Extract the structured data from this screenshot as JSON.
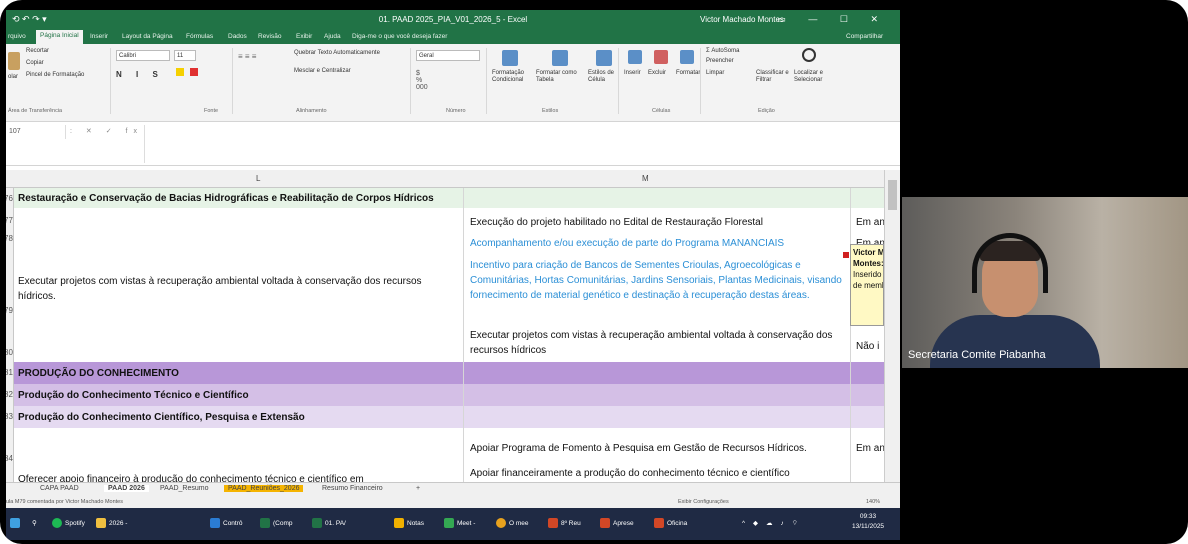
{
  "title_bar": {
    "quick_access": "⟲ ↶ ↷ ▾",
    "document_title": "01. PAAD 2025_PIA_V01_2026_5 - Excel",
    "user": "Victor Machado Montes",
    "window_controls": "▭ — ☐ ✕"
  },
  "ribbon_tabs": [
    "rquivo",
    "Página Inicial",
    "Inserir",
    "Layout da Página",
    "Fórmulas",
    "Dados",
    "Revisão",
    "Exibir",
    "Ajuda",
    "Diga-me o que você deseja fazer",
    "Compartilhar"
  ],
  "ribbon": {
    "clipboard": {
      "cut": "Recortar",
      "copy": "Copiar",
      "format_painter": "Pincel de Formatação",
      "paste": "olar",
      "label": "Área de Transferência"
    },
    "font": {
      "name": "Calibri",
      "size": "11",
      "label": "Fonte"
    },
    "alignment": {
      "wrap": "Quebrar Texto Automaticamente",
      "merge": "Mesclar e Centralizar",
      "label": "Alinhamento"
    },
    "number": {
      "format": "Geral",
      "label": "Número"
    },
    "styles": {
      "cond": "Formatação Condicional",
      "table": "Formatar como Tabela",
      "cell": "Estilos de Célula",
      "label": "Estilos"
    },
    "cells": {
      "insert": "Inserir",
      "delete": "Excluir",
      "format": "Formatar",
      "label": "Células"
    },
    "editing": {
      "autosum": "AutoSoma",
      "fill": "Preencher",
      "clear": "Limpar",
      "sort": "Classificar e Filtrar",
      "find": "Localizar e Selecionar",
      "label": "Edição"
    }
  },
  "formula_bar": {
    "name_box": "107",
    "fx": "fx",
    "content": ""
  },
  "columns": {
    "L": "L",
    "M": "M"
  },
  "rows": [
    {
      "num": "76",
      "L": "Restauração e Conservação de Bacias Hidrográficas e Reabilitação de Corpos Hídricos"
    },
    {
      "num": "77",
      "M": "Execução do projeto habilitado no Edital de Restauração Florestal",
      "N": "Em and"
    },
    {
      "num": "78",
      "M": "Acompanhamento e/ou execução de parte do Programa MANANCIAIS",
      "N": "Em and"
    },
    {
      "num": "79",
      "L": "Executar projetos com vistas à recuperação ambiental voltada à conservação dos recursos hídricos.",
      "M": "Incentivo para criação de Bancos de Sementes Crioulas, Agroecológicas e Comunitárias, Hortas Comunitárias, Jardins Sensoriais, Plantas Medicinais, visando fornecimento de material genético e destinação à recuperação destas áreas."
    },
    {
      "num": "80",
      "M": "Executar projetos com vistas à recuperação ambiental voltada à conservação dos recursos hídricos",
      "N": "Não i"
    },
    {
      "num": "81",
      "L": "PRODUÇÃO DO CONHECIMENTO"
    },
    {
      "num": "82",
      "L": "Produção do Conhecimento Técnico e Científico"
    },
    {
      "num": "83",
      "L": "Produção do Conhecimento Científico, Pesquisa e Extensão"
    },
    {
      "num": "84",
      "M": "Apoiar Programa de Fomento à Pesquisa em Gestão de Recursos Hídricos.",
      "N": "Em and"
    },
    {
      "num": "85",
      "L": "Oferecer apoio financeiro à produção do conhecimento técnico e científico em",
      "M": "Apoiar financeiramente a produção do conhecimento técnico e científico"
    }
  ],
  "comment": {
    "line1": "Victor M",
    "line2": "Montes:",
    "line3": "Inserido a",
    "line4": "de memb"
  },
  "sheet_tabs": [
    "CAPA PAAD",
    "PAAD 2026",
    "PAAD_Resumo",
    "PAAD_Reuniões_2026",
    "Resumo Financeiro",
    "+"
  ],
  "status": {
    "left": "ula M79 comentada por Victor Machado Montes",
    "display_settings": "Exibir Configurações",
    "zoom": "140%"
  },
  "taskbar": {
    "items": [
      "Spotify",
      "2026 -",
      "Contrô",
      "(Comp",
      "01. PA/",
      "Notas",
      "Meet -",
      "O mee",
      "8º Reu",
      "Aprese",
      "Oficina"
    ],
    "time": "09:33",
    "date": "13/11/2025"
  },
  "webcam": {
    "name": "Secretaria Comite Piabanha"
  },
  "colors": {
    "excel_green": "#217346",
    "purple1": "#b897d8",
    "purple2": "#d4bfe6",
    "purple3": "#e5daf1",
    "mint": "#e6f3e6",
    "link_blue": "#2b8fd6"
  }
}
